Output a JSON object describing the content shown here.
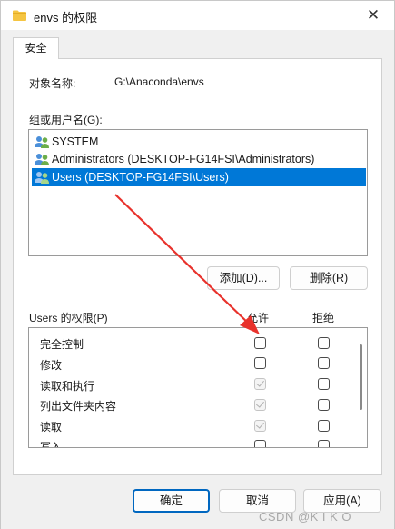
{
  "window": {
    "title": "envs 的权限",
    "close": "✕"
  },
  "tabs": [
    {
      "label": "安全"
    }
  ],
  "object": {
    "label": "对象名称:",
    "value": "G:\\Anaconda\\envs"
  },
  "groups": {
    "label": "组或用户名(G):",
    "items": [
      {
        "label": "SYSTEM",
        "icon": "users-group-icon"
      },
      {
        "label": "Administrators (DESKTOP-FG14FSI\\Administrators)",
        "icon": "users-group-icon"
      },
      {
        "label": "Users (DESKTOP-FG14FSI\\Users)",
        "icon": "users-group-icon",
        "selected": true
      }
    ],
    "add_button": "添加(D)...",
    "remove_button": "删除(R)"
  },
  "permissions": {
    "label": "Users 的权限(P)",
    "allow_header": "允许",
    "deny_header": "拒绝",
    "rows": [
      {
        "name": "完全控制",
        "allow": "unchecked",
        "deny": "unchecked"
      },
      {
        "name": "修改",
        "allow": "unchecked",
        "deny": "unchecked"
      },
      {
        "name": "读取和执行",
        "allow": "checked-disabled",
        "deny": "unchecked"
      },
      {
        "name": "列出文件夹内容",
        "allow": "checked-disabled",
        "deny": "unchecked"
      },
      {
        "name": "读取",
        "allow": "checked-disabled",
        "deny": "unchecked"
      },
      {
        "name": "写入",
        "allow": "unchecked",
        "deny": "unchecked"
      }
    ]
  },
  "footer": {
    "ok": "确定",
    "cancel": "取消",
    "apply": "应用(A)"
  },
  "watermark": "CSDN @K I K O",
  "colors": {
    "selection": "#0078d7",
    "primary_border": "#0067c0",
    "annotation_arrow": "#e8322c",
    "folder": "#f5c542"
  }
}
